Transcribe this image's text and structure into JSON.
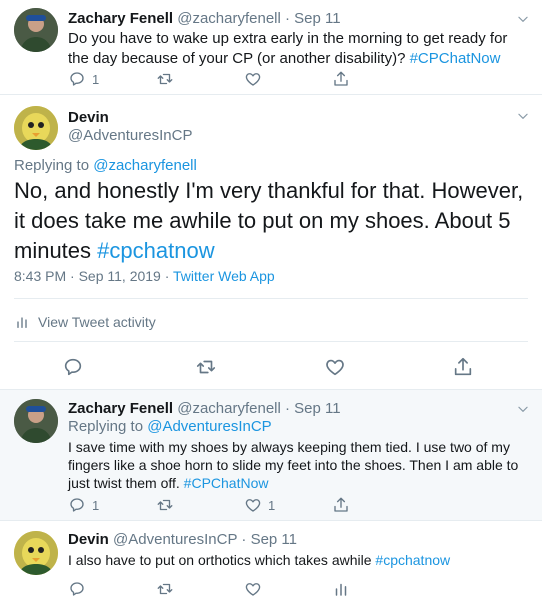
{
  "tweet1": {
    "name": "Zachary Fenell",
    "handle": "@zacharyfenell",
    "sep": "·",
    "date": "Sep 11",
    "text": "Do you have to wake up extra early in the morning to get ready for the day because of your CP (or another disability)?",
    "hashtag": "#CPChatNow",
    "reply_count": "1"
  },
  "main": {
    "name": "Devin",
    "handle": "@AdventuresInCP",
    "replying_prefix": "Replying to",
    "replying_to": "@zacharyfenell",
    "text": "No, and honestly I'm very thankful for that. However, it does take me awhile to put on my shoes. About 5 minutes",
    "hashtag": "#cpchatnow",
    "timestamp": "8:43 PM · Sep 11, 2019 ·",
    "source": "Twitter Web App",
    "activity_label": "View Tweet activity"
  },
  "tweet3": {
    "name": "Zachary Fenell",
    "handle": "@zacharyfenell",
    "sep": "·",
    "date": "Sep 11",
    "replying_prefix": "Replying to",
    "replying_to": "@AdventuresInCP",
    "text": "I save time with my shoes by always keeping them tied. I use two of my fingers like a shoe horn to slide my feet into the shoes. Then I am able to just twist them off.",
    "hashtag": "#CPChatNow",
    "reply_count": "1",
    "like_count": "1"
  },
  "tweet4": {
    "name": "Devin",
    "handle": "@AdventuresInCP",
    "sep": "·",
    "date": "Sep 11",
    "text": "I also have to put on orthotics which takes awhile",
    "hashtag": "#cpchatnow"
  },
  "colors": {
    "link": "#1b95e0",
    "muted": "#657786",
    "reply_bg": "#f5f8fa"
  },
  "icons": [
    "reply-icon",
    "retweet-icon",
    "like-icon",
    "share-icon",
    "activity-icon",
    "chevron-down-icon"
  ]
}
